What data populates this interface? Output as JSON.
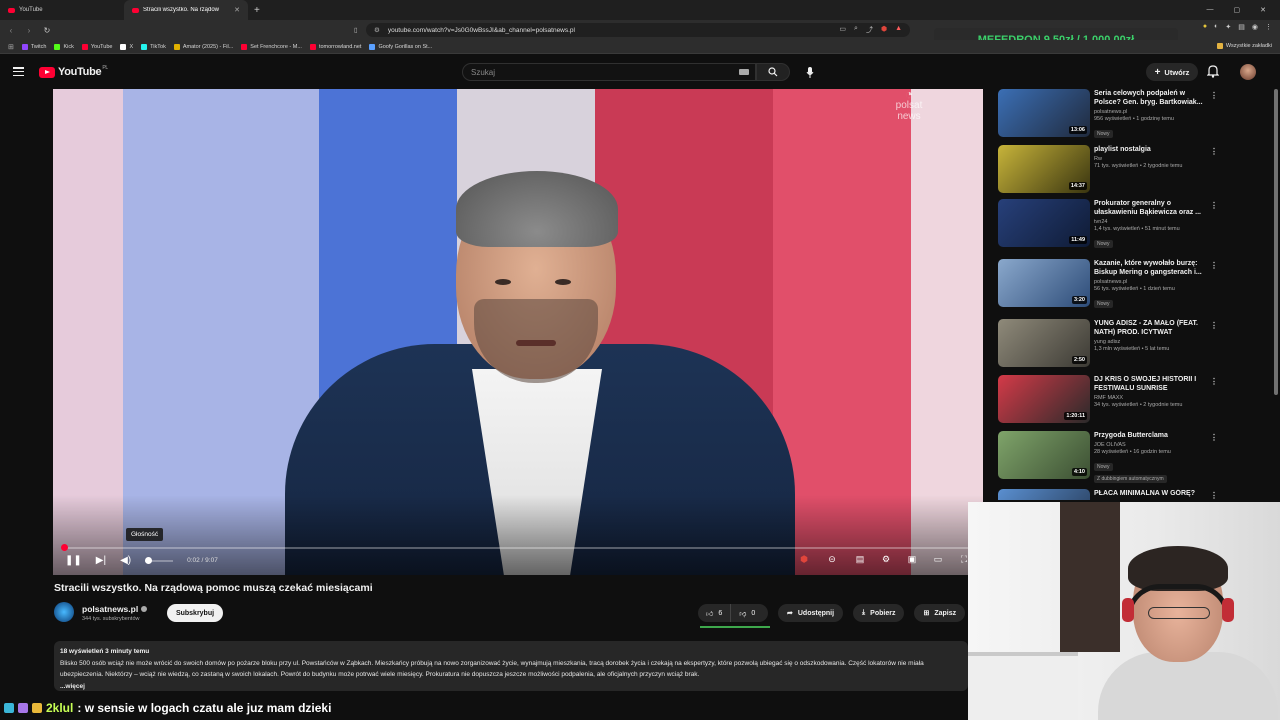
{
  "browser": {
    "tabs": [
      {
        "label": "YouTube",
        "active": false
      },
      {
        "label": "Stracili wszystko. Na rządow",
        "active": true
      }
    ],
    "url": "youtube.com/watch?v=Js0G0wBssJI&ab_channel=polsatnews.pl",
    "bookmarks": [
      {
        "label": "Twitch",
        "color": "#9146ff"
      },
      {
        "label": "Kick",
        "color": "#53fc18"
      },
      {
        "label": "YouTube",
        "color": "#ff0033"
      },
      {
        "label": "X",
        "color": "#ffffff"
      },
      {
        "label": "TikTok",
        "color": "#25f4ee"
      },
      {
        "label": "Amator (2025) - Fil...",
        "color": "#e0b000"
      },
      {
        "label": "Set Frenchcore - M...",
        "color": "#ff0033"
      },
      {
        "label": "tomorrowland.net",
        "color": "#ff0033"
      },
      {
        "label": "Goofy Gorillas on St...",
        "color": "#5aa0ff"
      }
    ],
    "all_bookmarks": "Wszystkie zakładki"
  },
  "overlay": {
    "mefedron": "MEFEDRON 9.50zł / 1,000.00zł"
  },
  "header": {
    "logo_text": "YouTube",
    "logo_region": "PL",
    "search_placeholder": "Szukaj",
    "create_label": "Utwórz"
  },
  "player": {
    "time": "0:02 / 9:07",
    "tooltip": "Głośność",
    "progress": 0.004,
    "volume": 0.0,
    "watermark_line1": "polsat",
    "watermark_line2": "news"
  },
  "video": {
    "title": "Stracili wszystko. Na rządową pomoc muszą czekać miesiącami",
    "channel": "polsatnews.pl",
    "subscribers": "344 tys. subskrybentów",
    "subscribe_label": "Subskrybuj",
    "likes": "6",
    "dislikes": "0",
    "share_label": "Udostępnij",
    "download_label": "Pobierz",
    "save_label": "Zapisz",
    "views_meta": "18 wyświetleń  3 minuty temu",
    "description": "Blisko 500 osób wciąż nie może wrócić do swoich domów po pożarze bloku przy ul. Powstańców w Ząbkach. Mieszkańcy próbują na nowo zorganizować życie, wynajmują mieszkania, tracą dorobek życia i czekają na ekspertyzy, które pozwolą ubiegać się o odszkodowania. Część lokatorów nie miała ubezpieczenia. Niektórzy – wciąż nie wiedzą, co zastaną w swoich lokalach. Powrót do budynku może potrwać wiele miesięcy. Prokuratura nie dopuszcza jeszcze możliwości podpalenia, ale oficjalnych przyczyn wciąż brak.",
    "more_label": "...więcej"
  },
  "recommendations": [
    {
      "title": "Seria celowych podpaleń w Polsce? Gen. bryg. Bartkowiak...",
      "channel": "polsatnews.pl",
      "meta": "956 wyświetleń • 1 godzinę temu",
      "badge": "Nowy",
      "duration": "13:06",
      "colors": [
        "#3b6fb5",
        "#202a3d"
      ]
    },
    {
      "title": "playlist nostalgia",
      "channel": "Rw",
      "meta": "71 tys. wyświetleń • 2 tygodnie temu",
      "badge": "",
      "duration": "14:37",
      "colors": [
        "#c7b43a",
        "#3a3510"
      ]
    },
    {
      "title": "Prokurator generalny o ułaskawieniu Bąkiewicza oraz ...",
      "channel": "tvn24",
      "meta": "1,4 tys. wyświetleń • 51 minut temu",
      "badge": "Nowy",
      "duration": "11:49",
      "colors": [
        "#27407a",
        "#0f1b35"
      ]
    },
    {
      "title": "Kazanie, które wywołało burzę: Biskup Mering o gangsterach i...",
      "channel": "polsatnews.pl",
      "meta": "56 tys. wyświetleń • 1 dzień temu",
      "badge": "Nowy",
      "duration": "3:20",
      "colors": [
        "#8aa8cc",
        "#2d4c78"
      ]
    },
    {
      "title": "YUNG ADISZ - ZA MAŁO (FEAT. NATH) PROD. ICYTWAT",
      "channel": "yung adisz",
      "meta": "1,3 mln wyświetleń • 5 lat temu",
      "badge": "",
      "duration": "2:50",
      "colors": [
        "#8f8a7a",
        "#3c3a34"
      ]
    },
    {
      "title": "DJ KRIS O SWOJEJ HISTORII I FESTIWALU SUNRISE",
      "channel": "RMF MAXX",
      "meta": "34 tys. wyświetleń • 2 tygodnie temu",
      "badge": "",
      "duration": "1:20:11",
      "colors": [
        "#d43a48",
        "#2a2a2a"
      ]
    },
    {
      "title": "Przygoda Butterclama",
      "channel": "JOE OLIVAS",
      "meta": "28 wyświetleń • 16 godzin temu",
      "badge": "Nowy",
      "badge2": "Z dubbingiem automatycznym",
      "duration": "4:10",
      "colors": [
        "#7fa46a",
        "#3c4f33"
      ]
    },
    {
      "title": "PŁACA MINIMALNA W GÓRĘ?",
      "channel": "",
      "meta": "",
      "badge": "",
      "duration": "",
      "colors": [
        "#5a8fd0",
        "#23354f"
      ]
    }
  ],
  "chat": {
    "username": "2klul",
    "message": ": w sensie w logach czatu ale juz mam dzieki"
  }
}
